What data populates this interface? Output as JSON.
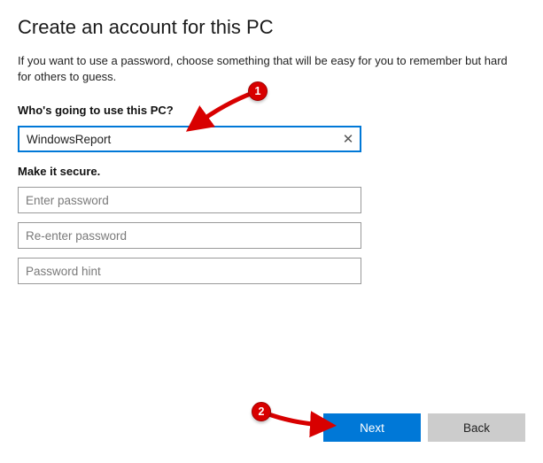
{
  "title": "Create an account for this PC",
  "description": "If you want to use a password, choose something that will be easy for you to remember but hard for others to guess.",
  "sections": {
    "who_label": "Who's going to use this PC?",
    "secure_label": "Make it secure."
  },
  "fields": {
    "username_value": "WindowsReport",
    "password_placeholder": "Enter password",
    "password_confirm_placeholder": "Re-enter password",
    "hint_placeholder": "Password hint"
  },
  "buttons": {
    "next_label": "Next",
    "back_label": "Back"
  },
  "icons": {
    "clear": "✕"
  },
  "annotations": {
    "one": "1",
    "two": "2"
  }
}
